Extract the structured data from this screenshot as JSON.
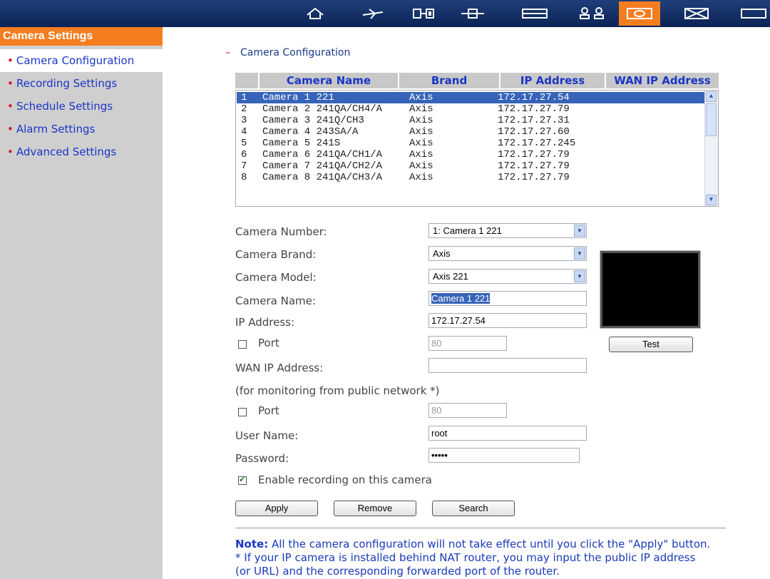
{
  "toolbar": {
    "icons": [
      "home-icon",
      "plane-icon",
      "film-icon",
      "plus-icon",
      "list-icon",
      "users-icon",
      "camera-icon",
      "envelope-icon",
      "folder-icon"
    ],
    "active": "camera-icon"
  },
  "sidebar": {
    "title": "Camera Settings",
    "items": [
      {
        "label": "Camera Configuration",
        "selected": true
      },
      {
        "label": "Recording Settings"
      },
      {
        "label": "Schedule Settings"
      },
      {
        "label": "Alarm Settings"
      },
      {
        "label": "Advanced Settings"
      }
    ]
  },
  "main": {
    "section_dash": "–",
    "section_title": "Camera Configuration",
    "table": {
      "headers": [
        "Camera Name",
        "Brand",
        "IP Address",
        "WAN IP Address"
      ],
      "rows": [
        {
          "n": "1",
          "name": "Camera 1 221",
          "brand": "Axis",
          "ip": "172.17.27.54"
        },
        {
          "n": "2",
          "name": "Camera 2 241QA/CH4/A",
          "brand": "Axis",
          "ip": "172.17.27.79"
        },
        {
          "n": "3",
          "name": "Camera 3 241Q/CH3",
          "brand": "Axis",
          "ip": "172.17.27.31"
        },
        {
          "n": "4",
          "name": "Camera 4 243SA/A",
          "brand": "Axis",
          "ip": "172.17.27.60"
        },
        {
          "n": "5",
          "name": "Camera 5 241S",
          "brand": "Axis",
          "ip": "172.17.27.245"
        },
        {
          "n": "6",
          "name": "Camera 6 241QA/CH1/A",
          "brand": "Axis",
          "ip": "172.17.27.79"
        },
        {
          "n": "7",
          "name": "Camera 7 241QA/CH2/A",
          "brand": "Axis",
          "ip": "172.17.27.79"
        },
        {
          "n": "8",
          "name": "Camera 8 241QA/CH3/A",
          "brand": "Axis",
          "ip": "172.17.27.79"
        }
      ]
    },
    "form": {
      "camera_number_label": "Camera Number:",
      "camera_number_value": "1: Camera 1 221",
      "camera_brand_label": "Camera Brand:",
      "camera_brand_value": "Axis",
      "camera_model_label": "Camera Model:",
      "camera_model_value": "Axis 221",
      "camera_name_label": "Camera Name:",
      "camera_name_value": "Camera 1 221",
      "ip_label": "IP Address:",
      "ip_value": "172.17.27.54",
      "port_label": "Port",
      "port_value": "80",
      "port_checked": false,
      "wan_label": "WAN IP Address:",
      "wan_value": "",
      "public_note": "(for monitoring from public network *)",
      "wan_port_label": "Port",
      "wan_port_value": "80",
      "wan_port_checked": false,
      "user_label": "User Name:",
      "user_value": "root",
      "password_label": "Password:",
      "password_value": "•••••",
      "enable_label": "Enable recording on this camera",
      "enable_checked": true,
      "test_button": "Test"
    },
    "buttons": {
      "apply": "Apply",
      "remove": "Remove",
      "search": "Search"
    },
    "note": {
      "bold": "Note:",
      "line1": " All the camera configuration will not take effect until you click the \"Apply\" button.",
      "line2": "* If your IP camera is installed behind NAT router, you may input the public IP address",
      "line3": "(or URL) and the corresponding forwarded port of the router."
    }
  },
  "colors": {
    "accent": "#f47d20",
    "link": "#1a35c8",
    "selection": "#3764b9"
  }
}
